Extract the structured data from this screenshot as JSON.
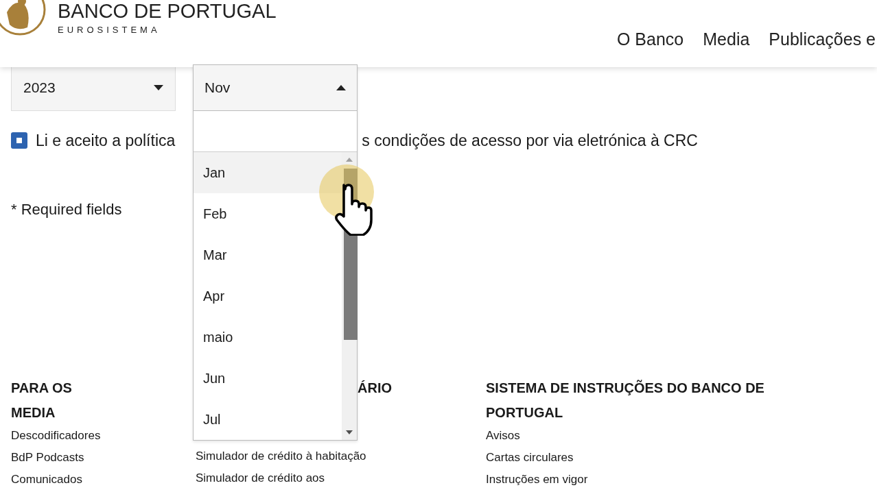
{
  "header": {
    "logo_title": "BANCO DE PORTUGAL",
    "logo_subtitle": "EUROSISTEMA",
    "nav": [
      "O Banco",
      "Media",
      "Publicações e"
    ]
  },
  "form": {
    "year_select": {
      "value": "2023",
      "expanded": false
    },
    "month_select": {
      "value": "Nov",
      "expanded": true,
      "options": [
        {
          "label": "Jan",
          "selected": true
        },
        {
          "label": "Feb",
          "selected": false
        },
        {
          "label": "Mar",
          "selected": false
        },
        {
          "label": "Apr",
          "selected": false
        },
        {
          "label": "maio",
          "selected": false
        },
        {
          "label": "Jun",
          "selected": false
        },
        {
          "label": "Jul",
          "selected": false
        }
      ]
    },
    "consent": {
      "checked": true,
      "text_before": "Li e aceito a política",
      "text_after": "s condições de acesso por via eletrónica à CRC"
    },
    "required_note": "* Required fields"
  },
  "footer": {
    "columns": [
      {
        "heading": "PARA OS MEDIA",
        "links": [
          "Descodificadores",
          "BdP Podcasts",
          "Comunicados"
        ]
      },
      {
        "heading": "ÁRIO",
        "links": [
          "Simulador de crédito à habitação",
          "Simulador de crédito aos"
        ]
      },
      {
        "heading": "SISTEMA DE INSTRUÇÕES DO BANCO DE PORTUGAL",
        "links": [
          "Avisos",
          "Cartas circulares",
          "Instruções em vigor"
        ]
      }
    ]
  }
}
